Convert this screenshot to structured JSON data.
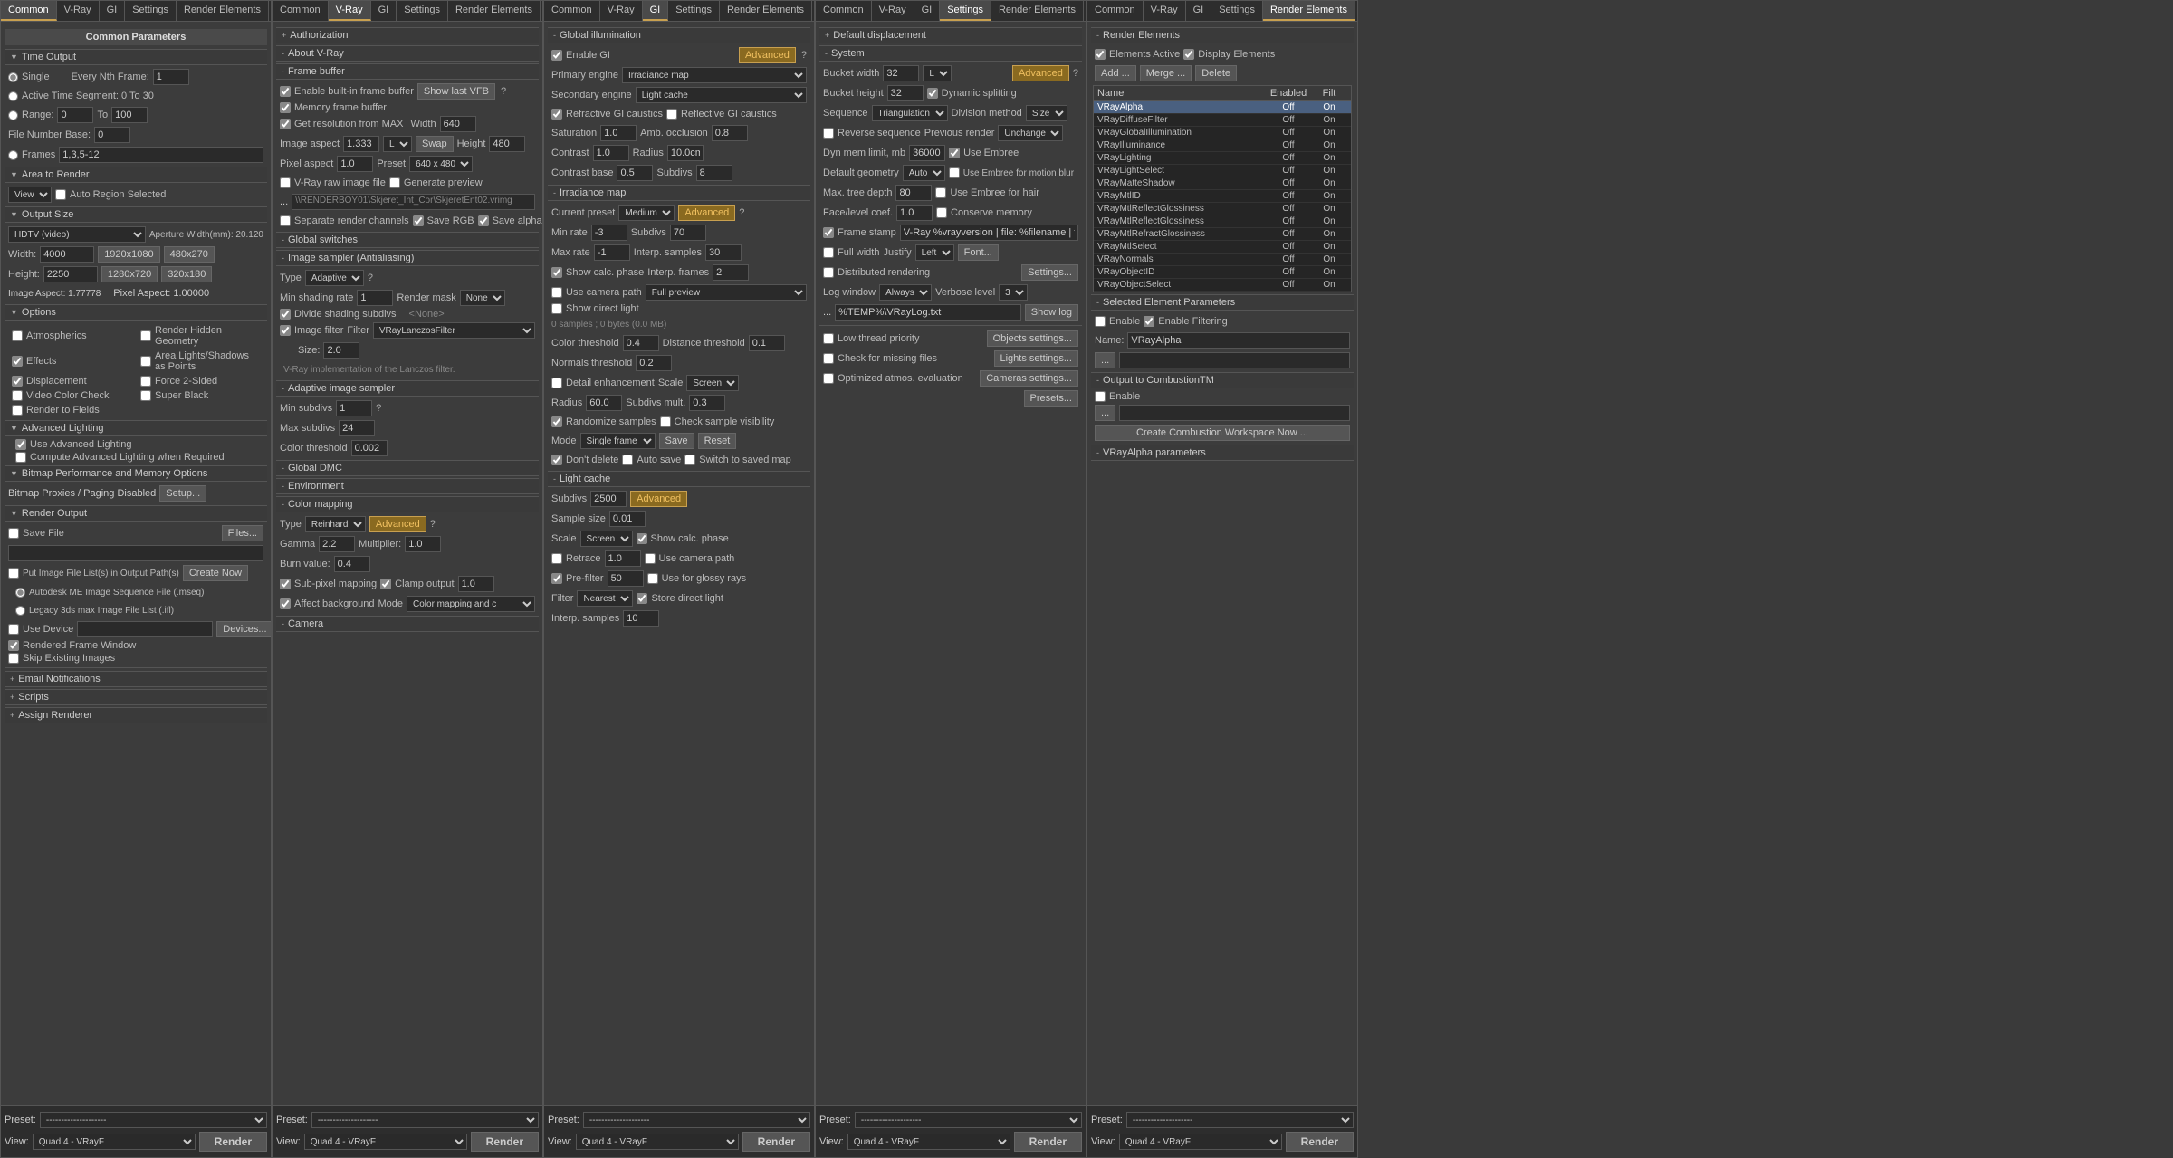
{
  "panels": [
    {
      "id": "common",
      "tabs": [
        "Common",
        "V-Ray",
        "GI",
        "Settings",
        "Render Elements"
      ],
      "active_tab": "Common",
      "title": "Common Parameters",
      "sections": {
        "time_output": {
          "label": "Time Output",
          "single": "Single",
          "every_nth": "Every Nth Frame:",
          "active_time": "Active Time Segment:",
          "range_label": "Range:",
          "range_from": "0",
          "range_to": "To",
          "range_to_val": "100",
          "file_number": "File Number Base:",
          "file_number_val": "0",
          "frames_label": "Frames",
          "frames_val": "1,3,5-12"
        },
        "area_to_render": {
          "label": "Area to Render",
          "view": "View",
          "auto_region": "Auto Region Selected"
        },
        "output_size": {
          "label": "Output Size",
          "preset": "HDTV (video)",
          "aperture": "Aperture Width(mm): 20.120",
          "width_label": "Width:",
          "width": "4000",
          "res1": "1920x1080",
          "res2": "480x270",
          "height_label": "Height:",
          "height": "2250",
          "res3": "1280x720",
          "res4": "320x180",
          "image_aspect": "Image Aspect: 1.77778",
          "pixel_aspect": "Pixel Aspect: 1.00000"
        },
        "options": {
          "label": "Options",
          "atmospherics": "Atmospherics",
          "render_hidden": "Render Hidden Geometry",
          "effects": "Effects",
          "area_lights": "Area Lights/Shadows as Points",
          "displacement": "Displacement",
          "force_2sided": "Force 2-Sided",
          "video_color": "Video Color Check",
          "super_black": "Super Black",
          "render_fields": "Render to Fields"
        },
        "advanced_lighting": {
          "label": "Advanced Lighting",
          "use_advanced": "Use Advanced Lighting",
          "compute_advanced": "Compute Advanced Lighting when Required"
        },
        "bitmap": {
          "label": "Bitmap Performance and Memory Options",
          "bitmap_proxies": "Bitmap Proxies / Paging Disabled",
          "setup": "Setup..."
        },
        "render_output": {
          "label": "Render Output",
          "save_file": "Save File",
          "files_btn": "Files...",
          "put_image": "Put Image File List(s) in Output Path(s)",
          "create_now": "Create Now",
          "autodesk": "Autodesk ME Image Sequence File (.mseq)",
          "legacy": "Legacy 3ds max Image File List (.ifl)",
          "use_device": "Use Device",
          "devices_btn": "Devices...",
          "rendered_frame": "Rendered Frame Window",
          "skip_existing": "Skip Existing Images"
        },
        "email": "Email Notifications",
        "scripts": "Scripts",
        "assign_renderer": "Assign Renderer"
      },
      "footer": {
        "preset_label": "Preset:",
        "preset_val": "--------------------",
        "view_label": "View:",
        "view_val": "Quad 4 - VRayF",
        "render_btn": "Render"
      }
    },
    {
      "id": "vray",
      "tabs": [
        "Common",
        "V-Ray",
        "GI",
        "Settings",
        "Render Elements"
      ],
      "active_tab": "V-Ray",
      "sections": {
        "authorization": "Authorization",
        "about": "About V-Ray",
        "frame_buffer": {
          "label": "Frame buffer",
          "enable_builtin": "Enable built-in frame buffer",
          "show_last": "Show last VFB",
          "memory_frame": "Memory frame buffer",
          "get_resolution": "Get resolution from MAX",
          "width": "640",
          "height": "480",
          "swap": "Swap",
          "image_aspect": "Image aspect",
          "image_aspect_val": "1.333",
          "size": "L",
          "height_label": "Height",
          "height_val": "480",
          "pixel_aspect": "Pixel aspect",
          "pixel_aspect_val": "1.0",
          "preset": "640 x 480",
          "vray_raw": "V-Ray raw image file",
          "generate_preview": "Generate preview",
          "path": "\\\\RENDERBOY01\\Skjeret_Int_Cor\\SkjeretEnt02.vrimg",
          "separate_channels": "Separate render channels",
          "save_rgb": "Save RGB",
          "save_alpha": "Save alpha"
        },
        "global_switches": "Global switches",
        "image_sampler": {
          "label": "Image sampler (Antialiasing)",
          "type_label": "Type",
          "type_val": "Adaptive",
          "min_shading": "Min shading rate",
          "min_shading_val": "1",
          "render_mask": "Render mask",
          "render_mask_val": "None",
          "divide_shading": "Divide shading subdivs",
          "none_val": "<None>"
        },
        "image_filter": {
          "enabled": true,
          "label": "Image filter",
          "filter": "Filter",
          "filter_val": "VRayLanczosFilter",
          "size": "Size:",
          "size_val": "2.0",
          "description": "V-Ray implementation of the Lanczos filter."
        },
        "adaptive_sampler": {
          "label": "Adaptive image sampler",
          "min_subdivs": "Min subdivs",
          "min_val": "1",
          "max_subdivs": "Max subdivs",
          "max_val": "24",
          "color_threshold": "Color threshold",
          "color_val": "0.002"
        },
        "global_dmc": "Global DMC",
        "environment": "Environment",
        "color_mapping": {
          "label": "Color mapping",
          "type": "Type",
          "type_val": "Reinhard",
          "advanced_btn": "Advanced",
          "gamma": "Gamma",
          "gamma_val": "2.2",
          "multiplier": "Multiplier:",
          "multiplier_val": "1.0",
          "burn_value": "Burn value:",
          "burn_val": "0.4",
          "sub_pixel": "Sub-pixel mapping",
          "clamp_output": "Clamp output",
          "clamp_val": "1.0",
          "affect_bg": "Affect background",
          "mode": "Mode",
          "mode_val": "Color mapping and c"
        },
        "camera": "Camera"
      },
      "footer": {
        "preset_label": "Preset:",
        "preset_val": "--------------------",
        "view_label": "View:",
        "view_val": "Quad 4 - VRayF",
        "render_btn": "Render"
      }
    },
    {
      "id": "gi",
      "tabs": [
        "Common",
        "V-Ray",
        "GI",
        "Settings",
        "Render Elements"
      ],
      "active_tab": "GI",
      "sections": {
        "global_illumination": {
          "label": "Global illumination",
          "enable_gi": "Enable GI",
          "advanced_btn": "Advanced",
          "primary_engine": "Primary engine",
          "primary_val": "Irradiance map",
          "secondary_engine": "Secondary engine",
          "secondary_val": "Light cache",
          "refractive": "Refractive GI caustics",
          "reflective": "Reflective GI caustics",
          "saturation": "Saturation",
          "sat_val": "1.0",
          "amb_occlusion": "Amb. occlusion",
          "amb_val": "0.8",
          "contrast": "Contrast",
          "cont_val": "1.0",
          "radius": "Radius",
          "radius_val": "10.0cm",
          "contrast_base": "Contrast base",
          "cont_base_val": "0.5",
          "subdivs": "Subdivs",
          "subdivs_val": "8"
        },
        "irradiance_map": {
          "label": "Irradiance map",
          "current_preset": "Current preset",
          "preset_val": "Medium",
          "advanced_btn": "Advanced",
          "min_rate": "Min rate",
          "min_val": "-3",
          "subdivs": "Subdivs",
          "subdivs_val": "70",
          "max_rate": "Max rate",
          "max_val": "-1",
          "interp_samples": "Interp. samples",
          "interp_val": "30",
          "show_calc": "Show calc. phase",
          "interp_frames": "Interp. frames",
          "interp_frames_val": "2",
          "use_camera_path": "Use camera path",
          "full_preview": "Full preview",
          "show_direct": "Show direct light",
          "bytes_info": "0 samples ; 0 bytes (0.0 MB)",
          "color_threshold": "Color threshold",
          "color_val": "0.4",
          "distance_threshold": "Distance threshold",
          "dist_val": "0.1",
          "normals_threshold": "Normals threshold",
          "norm_val": "0.2",
          "detail_enhancement": "Detail enhancement",
          "scale": "Scale",
          "scale_val": "Screen",
          "radius": "Radius",
          "radius_val": "60.0",
          "subdivs_mult": "Subdivs mult.",
          "subdivs_mult_val": "0.3",
          "randomize": "Randomize samples",
          "check_sample": "Check sample visibility",
          "mode": "Mode",
          "mode_val": "Single frame",
          "save_btn": "Save",
          "reset_btn": "Reset",
          "dont_delete": "Don't delete",
          "auto_save": "Auto save",
          "switch_to_saved": "Switch to saved map"
        },
        "light_cache": {
          "label": "Light cache",
          "subdivs": "Subdivs",
          "subdivs_val": "2500",
          "advanced_btn": "Advanced",
          "sample_size": "Sample size",
          "sample_val": "0.01",
          "scale": "Scale",
          "scale_val": "Screen",
          "show_calc": "Show calc. phase",
          "retrace": "Retrace",
          "retrace_val": "1.0",
          "use_camera_path": "Use camera path",
          "pre_filter": "Pre-filter",
          "pre_val": "50",
          "use_glossy": "Use for glossy rays",
          "filter": "Filter",
          "filter_val": "Nearest",
          "store_direct": "Store direct light",
          "interp_samples": "Interp. samples",
          "interp_val": "10"
        }
      },
      "footer": {
        "preset_label": "Preset:",
        "preset_val": "--------------------",
        "view_label": "View:",
        "view_val": "Quad 4 - VRayF",
        "render_btn": "Render"
      }
    },
    {
      "id": "settings",
      "tabs": [
        "Common",
        "V-Ray",
        "GI",
        "Settings",
        "Render Elements"
      ],
      "active_tab": "Settings",
      "sections": {
        "default_displacement": {
          "label": "Default displacement",
          "system": "System",
          "bucket_width": "Bucket width",
          "bucket_width_val": "32",
          "size_label": "L",
          "advanced_btn": "Advanced",
          "bucket_height": "Bucket height",
          "bucket_height_val": "32",
          "dynamic_splitting": "Dynamic splitting",
          "sequence": "Sequence",
          "sequence_val": "Triangulation",
          "division_method": "Division method",
          "division_val": "Size",
          "reverse_sequence": "Reverse sequence",
          "previous_render": "Previous render",
          "previous_val": "Unchange",
          "dyn_mem": "Dyn mem limit, mb",
          "dyn_mem_val": "36000",
          "use_embree": "Use Embree",
          "default_geometry": "Default geometry",
          "default_geo_val": "Auto",
          "embree_motion_blur": "Use Embree for motion blur",
          "max_tree_depth": "Max. tree depth",
          "max_tree_val": "80",
          "embree_hair": "Use Embree for hair",
          "face_level": "Face/level coef.",
          "face_level_val": "1.0",
          "conserve_memory": "Conserve memory",
          "frame_stamp": "Frame stamp",
          "frame_stamp_val": "V-Ray %vrayversion | file: %filename | frame",
          "full_width": "Full width",
          "justify": "Justify",
          "justify_val": "Left",
          "font_btn": "Font...",
          "distributed_rendering": "Distributed rendering",
          "settings_btn": "Settings...",
          "log_window": "Log window",
          "log_val": "Always",
          "verbose_level": "Verbose level",
          "verbose_val": "3",
          "show_log": "Show log",
          "log_path": "%TEMP%\\VRayLog.txt",
          "low_thread": "Low thread priority",
          "objects_settings": "Objects settings...",
          "check_missing": "Check for missing files",
          "lights_settings": "Lights settings...",
          "optimized_atmos": "Optimized atmos. evaluation",
          "cameras_settings": "Cameras settings...",
          "presets_btn": "Presets..."
        }
      },
      "footer": {
        "preset_label": "Preset:",
        "preset_val": "--------------------",
        "view_label": "View:",
        "view_val": "Quad 4 - VRayF",
        "render_btn": "Render"
      }
    },
    {
      "id": "render_elements",
      "tabs": [
        "Common",
        "V-Ray",
        "GI",
        "Settings",
        "Render Elements"
      ],
      "active_tab": "Render Elements",
      "sections": {
        "elements": {
          "label": "Render Elements",
          "elements_active": "Elements Active",
          "display_elements": "Display Elements",
          "add_btn": "Add ...",
          "merge_btn": "Merge ...",
          "delete_btn": "Delete",
          "table_headers": [
            "Name",
            "Enabled",
            "Filt"
          ],
          "rows": [
            {
              "name": "VRayAlpha",
              "enabled": "Off",
              "filter": "On",
              "selected": true
            },
            {
              "name": "VRayDiffuseFilter",
              "enabled": "Off",
              "filter": "On"
            },
            {
              "name": "VRayGlobalIllumination",
              "enabled": "Off",
              "filter": "On"
            },
            {
              "name": "VRayIlluminance",
              "enabled": "Off",
              "filter": "On"
            },
            {
              "name": "VRayLighting",
              "enabled": "Off",
              "filter": "On"
            },
            {
              "name": "VRayLightSelect",
              "enabled": "Off",
              "filter": "On"
            },
            {
              "name": "VRayMatteShadow",
              "enabled": "Off",
              "filter": "On"
            },
            {
              "name": "VRayMtlID",
              "enabled": "Off",
              "filter": "On"
            },
            {
              "name": "VRayMtlReflectGlossiness",
              "enabled": "Off",
              "filter": "On"
            },
            {
              "name": "VRayMtlReflectGlossiness",
              "enabled": "Off",
              "filter": "On"
            },
            {
              "name": "VRayMtlRefractGlossiness",
              "enabled": "Off",
              "filter": "On"
            },
            {
              "name": "VRayMtlSelect",
              "enabled": "Off",
              "filter": "On"
            },
            {
              "name": "VRayNormals",
              "enabled": "Off",
              "filter": "On"
            },
            {
              "name": "VRayObjectID",
              "enabled": "Off",
              "filter": "On"
            },
            {
              "name": "VRayObjectSelect",
              "enabled": "Off",
              "filter": "On"
            }
          ]
        },
        "selected_params": {
          "label": "Selected Element Parameters",
          "enable": "Enable",
          "enable_filtering": "Enable Filtering",
          "name_label": "Name:",
          "name_val": "VRayAlpha",
          "btn1": "...",
          "output_combustion": "Output to CombustionTM",
          "combustion_enable": "Enable",
          "combustion_btn": "...",
          "create_combustion": "Create Combustion Workspace Now ..."
        },
        "vray_alpha_params": "VRayAlpha parameters"
      },
      "footer": {
        "preset_label": "Preset:",
        "preset_val": "--------------------",
        "view_label": "View:",
        "view_val": "Quad 4 - VRayF",
        "render_btn": "Render"
      }
    }
  ]
}
